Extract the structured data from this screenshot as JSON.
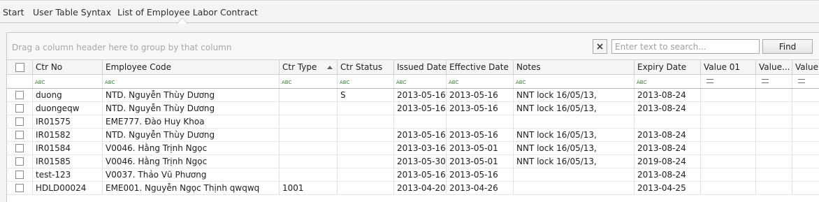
{
  "tabs": [
    {
      "label": "Start"
    },
    {
      "label": "User Table Syntax"
    },
    {
      "label": "List of Employee Labor Contract"
    }
  ],
  "group_hint": "Drag a column header here to group by that column",
  "search": {
    "placeholder": "Enter text to search...",
    "value": "",
    "find_label": "Find",
    "clear_icon": "close-icon"
  },
  "columns": [
    "Ctr No",
    "Employee Code",
    "Ctr Type",
    "Ctr Status",
    "Issued Date",
    "Effective Date",
    "Notes",
    "Expiry Date",
    "Value 01",
    "Value...",
    "Value"
  ],
  "sorted_column": "Ctr Type",
  "filter_icons": [
    "abc-icon",
    "abc-icon",
    "abc-icon",
    "abc-icon",
    "abc-icon",
    "abc-icon",
    "abc-icon",
    "abc-icon",
    "equals-icon",
    "equals-icon",
    "equals-icon"
  ],
  "rows": [
    {
      "ctr_no": "duong",
      "employee": "NTD. Nguyễn Thùy  Dương",
      "ctr_type": "",
      "ctr_status": "S",
      "issued": "2013-05-16",
      "effective": "2013-05-16",
      "notes": "NNT lock 16/05/13,",
      "expiry": "2013-08-24"
    },
    {
      "ctr_no": "duongeqw",
      "employee": "NTD. Nguyễn Thùy  Dương",
      "ctr_type": "",
      "ctr_status": "",
      "issued": "2013-05-16",
      "effective": "2013-05-16",
      "notes": "NNT lock 16/05/13,",
      "expiry": "2013-08-24"
    },
    {
      "ctr_no": "IR01575",
      "employee": "EME777. Đào Huy Khoa",
      "ctr_type": "",
      "ctr_status": "",
      "issued": "",
      "effective": "",
      "notes": "",
      "expiry": ""
    },
    {
      "ctr_no": "IR01582",
      "employee": "NTD. Nguyễn Thùy  Dương",
      "ctr_type": "",
      "ctr_status": "",
      "issued": "2013-05-16",
      "effective": "2013-05-16",
      "notes": "NNT lock 16/05/13,",
      "expiry": "2013-08-24"
    },
    {
      "ctr_no": "IR01584",
      "employee": "V0046. Hằng  Trịnh Ngọc",
      "ctr_type": "",
      "ctr_status": "",
      "issued": "2013-03-16",
      "effective": "2013-05-01",
      "notes": "NNT lock 16/05/13,",
      "expiry": "2013-08-24"
    },
    {
      "ctr_no": "IR01585",
      "employee": "V0046. Hằng  Trịnh Ngọc",
      "ctr_type": "",
      "ctr_status": "",
      "issued": "2013-05-30",
      "effective": "2013-05-01",
      "notes": "NNT lock 16/05/13,",
      "expiry": "2019-08-24"
    },
    {
      "ctr_no": "test-123",
      "employee": "V0037. Thảo  Vũ Phương",
      "ctr_type": "",
      "ctr_status": "",
      "issued": "2013-05-16",
      "effective": "2013-05-16",
      "notes": "",
      "expiry": "2013-08-24"
    },
    {
      "ctr_no": "HDLD00024",
      "employee": "EME001. Nguyễn Ngọc Thịnh  qwqwq",
      "ctr_type": "1001",
      "ctr_status": "",
      "issued": "2013-04-20",
      "effective": "2013-04-26",
      "notes": "",
      "expiry": "2013-04-25"
    }
  ]
}
